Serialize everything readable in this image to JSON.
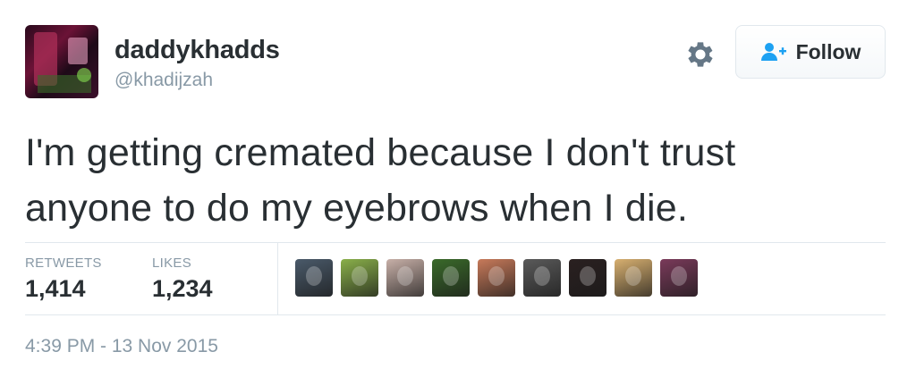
{
  "user": {
    "display_name": "daddykhadds",
    "handle": "@khadijzah"
  },
  "follow_button": {
    "label": "Follow"
  },
  "tweet": {
    "line1": "I'm getting cremated because I don't trust",
    "line2": "anyone to do my eyebrows when I die."
  },
  "stats": {
    "retweets_label": "RETWEETS",
    "retweets_value": "1,414",
    "likes_label": "LIKES",
    "likes_value": "1,234"
  },
  "likers": [
    {
      "color": "#4a5a6a"
    },
    {
      "color": "#8ab04a"
    },
    {
      "color": "#c8b0a8"
    },
    {
      "color": "#3a6a2a"
    },
    {
      "color": "#c87a5a"
    },
    {
      "color": "#5a5a5a"
    },
    {
      "color": "#2a2020"
    },
    {
      "color": "#d8b070"
    },
    {
      "color": "#7a3a5a"
    }
  ],
  "timestamp": "4:39 PM - 13 Nov 2015",
  "colors": {
    "text": "#292f33",
    "muted": "#8899a6",
    "follow_icon": "#1da1f2",
    "border": "#e1e8ed"
  }
}
